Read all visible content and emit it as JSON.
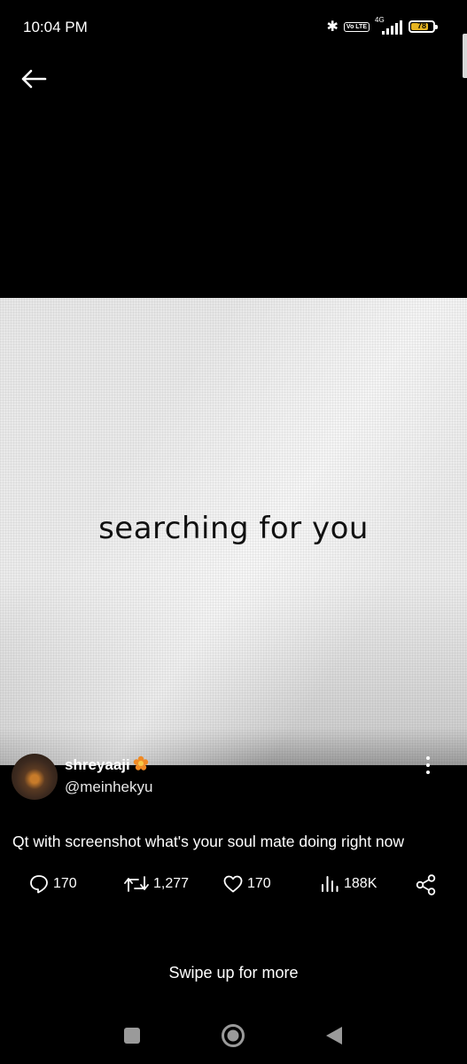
{
  "status_bar": {
    "time": "10:04 PM",
    "volte_label": "Vo LTE",
    "network_type": "4G",
    "battery_percent": "78",
    "battery_level": 0.78,
    "battery_color": "#e6b422"
  },
  "media": {
    "caption_text": "searching for you"
  },
  "tweet": {
    "display_name": "shreyaaji",
    "badge_icon": "orange-flower-emoji",
    "handle": "@meinhekyu",
    "text": "Qt with screenshot what's your soul mate doing right now",
    "replies": "170",
    "retweets": "1,277",
    "likes": "170",
    "views": "188K"
  },
  "footer": {
    "swipe_hint": "Swipe up for more"
  },
  "icons": {
    "back": "arrow-left-icon",
    "more": "more-vertical-icon",
    "reply": "speech-bubble-icon",
    "retweet": "retweet-icon",
    "like": "heart-icon",
    "views": "bar-chart-icon",
    "share": "share-icon"
  }
}
